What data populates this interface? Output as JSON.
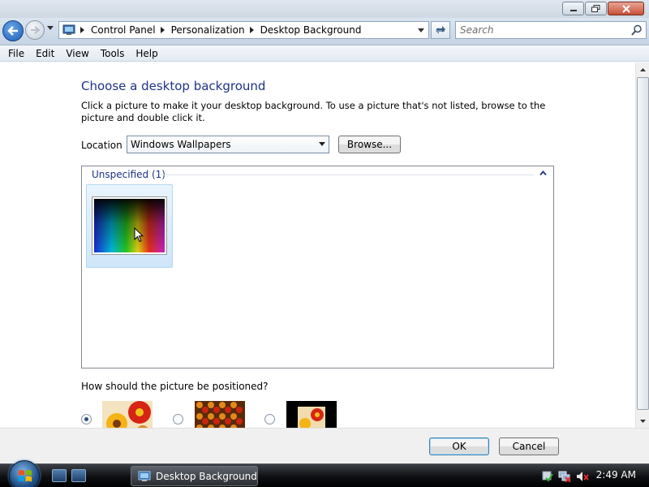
{
  "window": {
    "caption_buttons": [
      "minimize-icon",
      "maximize-icon",
      "close-icon"
    ]
  },
  "addressbar": {
    "breadcrumbs": [
      "Control Panel",
      "Personalization",
      "Desktop Background"
    ],
    "search_placeholder": "Search"
  },
  "menubar": {
    "items": [
      "File",
      "Edit",
      "View",
      "Tools",
      "Help"
    ]
  },
  "main": {
    "title": "Choose a desktop background",
    "description": "Click a picture to make it your desktop background. To use a picture that's not listed, browse to the picture and double click it.",
    "location_label": "Location",
    "location_value": "Windows Wallpapers",
    "browse_label": "Browse...",
    "group_header": "Unspecified (1)",
    "position_question": "How should the picture be positioned?",
    "position_options": [
      "fit-to-screen",
      "tile",
      "center"
    ],
    "position_selected": 0
  },
  "footer": {
    "ok_label": "OK",
    "cancel_label": "Cancel"
  },
  "taskbar": {
    "task_label": "Desktop Background",
    "clock": "2:49 AM"
  },
  "colors": {
    "title_blue": "#1e3287",
    "selection_tile": "#cfe6f9",
    "taskbar": "#0d0f12"
  }
}
